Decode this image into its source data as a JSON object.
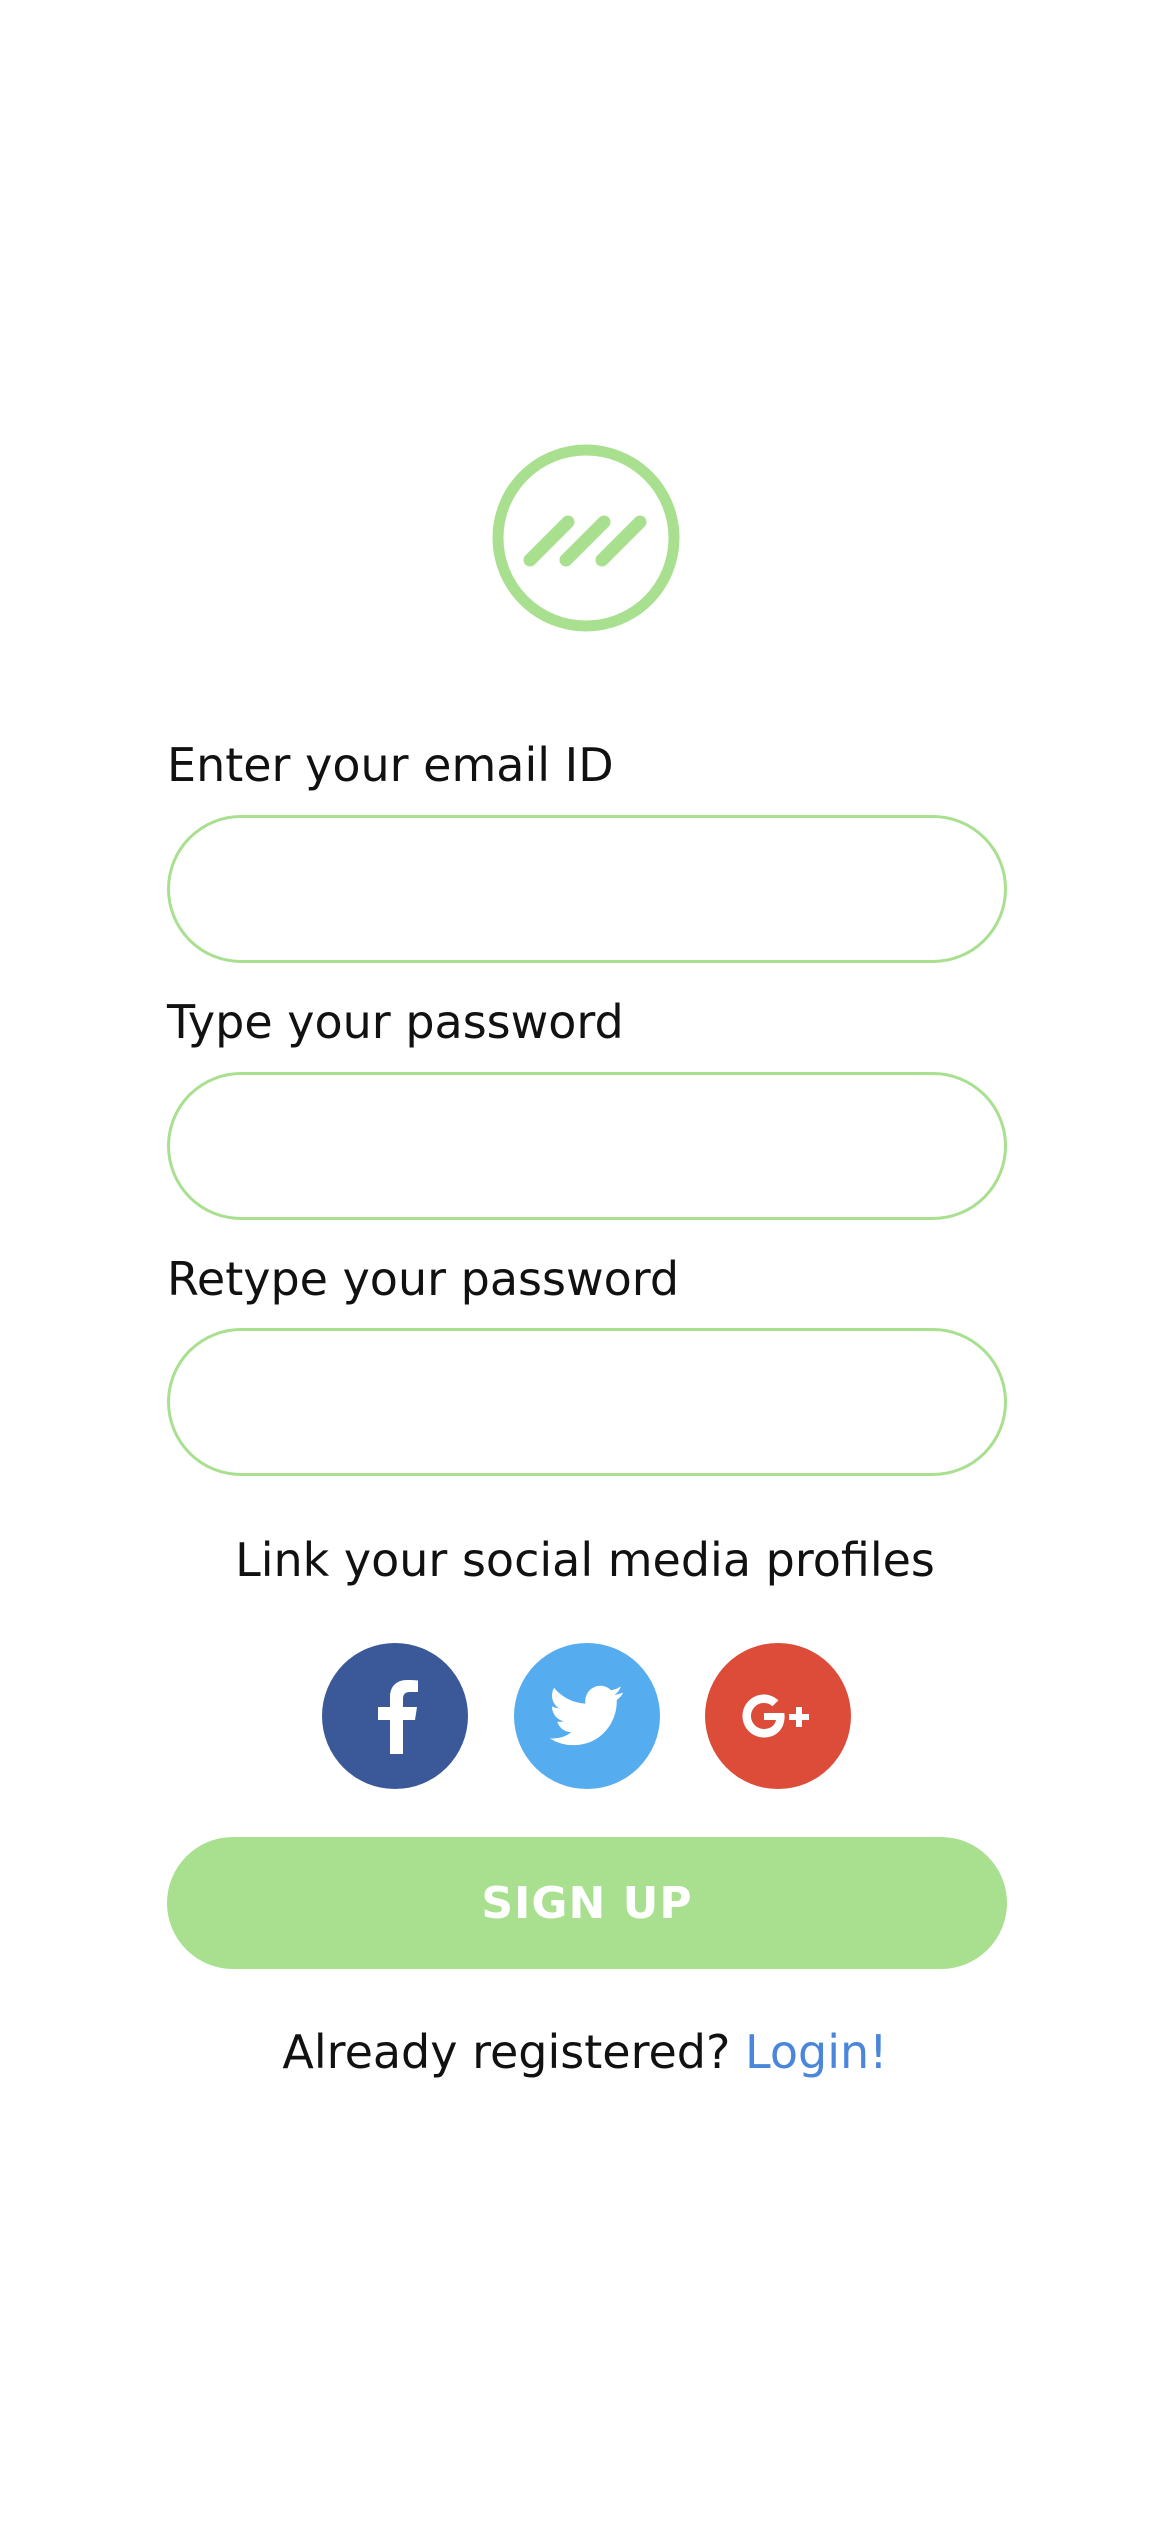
{
  "form": {
    "email_label": "Enter your email ID",
    "email_value": "",
    "password_label": "Type your password",
    "password_value": "",
    "retype_label": "Retype your password",
    "retype_value": ""
  },
  "social": {
    "title": "Link your social media profiles",
    "buttons": [
      {
        "icon": "facebook-icon",
        "color": "#3b5998"
      },
      {
        "icon": "twitter-icon",
        "color": "#55acee"
      },
      {
        "icon": "google-plus-icon",
        "color": "#dd4b39"
      }
    ]
  },
  "signup": {
    "label": "SIGN UP"
  },
  "footer": {
    "prompt": "Already registered? ",
    "link": "Login!"
  },
  "colors": {
    "accent": "#a8e08f",
    "link": "#4a86d9"
  }
}
